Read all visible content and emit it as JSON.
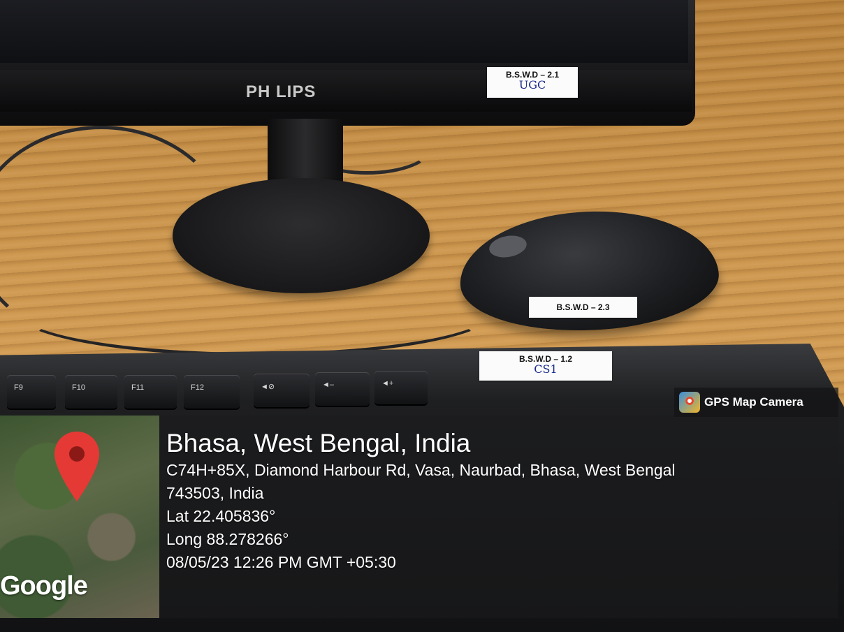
{
  "stickers": {
    "monitor": {
      "line1": "B.S.W.D – 2.1",
      "hand": "UGC"
    },
    "mouse": {
      "line1": "B.S.W.D – 2.3"
    },
    "keyboard": {
      "line1": "B.S.W.D – 1.2",
      "hand": "CS1"
    }
  },
  "monitor_brand": "PH LIPS",
  "keyboard_keys": [
    "F9",
    "F10",
    "F11",
    "F12",
    "◄⊘",
    "◄–",
    "◄+"
  ],
  "gps_badge": {
    "label": "GPS Map Camera"
  },
  "map": {
    "attribution": "Google"
  },
  "location": {
    "title": "Bhasa, West Bengal, India",
    "address_line1": "C74H+85X, Diamond Harbour Rd, Vasa, Naurbad, Bhasa, West Bengal",
    "address_line2": "743503, India",
    "lat": "Lat 22.405836°",
    "long": "Long 88.278266°",
    "datetime": "08/05/23 12:26 PM GMT +05:30"
  },
  "colors": {
    "pin": "#e53935",
    "overlay": "#1c1c1e"
  }
}
